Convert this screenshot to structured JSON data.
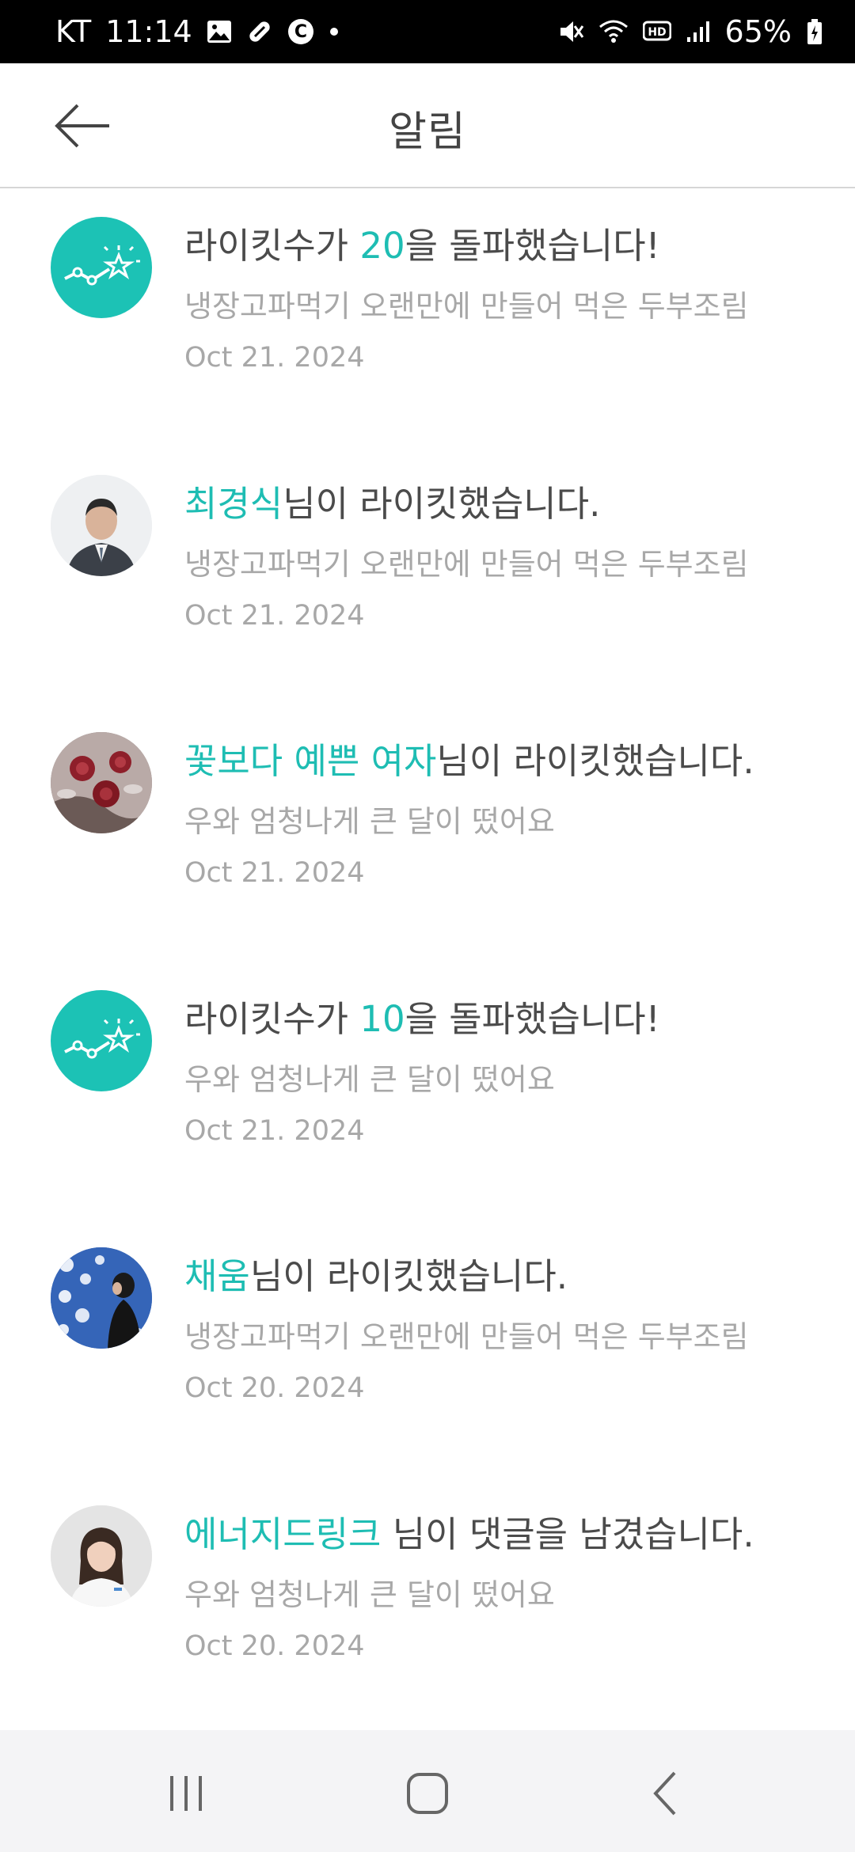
{
  "status_bar": {
    "carrier": "KT",
    "time": "11:14",
    "battery": "65%"
  },
  "app_bar": {
    "title": "알림"
  },
  "notifications": [
    {
      "type": "milestone",
      "prefix": "라이킷수가 ",
      "highlight": "20",
      "suffix": "을 돌파했습니다!",
      "subtitle": "냉장고파먹기 오랜만에 만들어 먹은 두부조림",
      "date": "Oct 21. 2024"
    },
    {
      "type": "like",
      "prefix": "",
      "highlight": "최경식",
      "suffix": "님이 라이킷했습니다.",
      "subtitle": "냉장고파먹기 오랜만에 만들어 먹은 두부조림",
      "date": "Oct 21. 2024"
    },
    {
      "type": "like",
      "prefix": "",
      "highlight": "꽃보다 예쁜 여자",
      "suffix": "님이 라이킷했습니다.",
      "subtitle": "우와 엄청나게 큰 달이 떴어요",
      "date": "Oct 21. 2024"
    },
    {
      "type": "milestone",
      "prefix": "라이킷수가 ",
      "highlight": "10",
      "suffix": "을 돌파했습니다!",
      "subtitle": "우와 엄청나게 큰 달이 떴어요",
      "date": "Oct 21. 2024"
    },
    {
      "type": "like",
      "prefix": "",
      "highlight": "채움",
      "suffix": "님이 라이킷했습니다.",
      "subtitle": "냉장고파먹기 오랜만에 만들어 먹은 두부조림",
      "date": "Oct 20. 2024"
    },
    {
      "type": "comment",
      "prefix": "",
      "highlight": "에너지드링크",
      "suffix": " 님이 댓글을 남겼습니다.",
      "subtitle": "우와 엄청나게 큰 달이 떴어요",
      "date": "Oct 20. 2024"
    }
  ],
  "colors": {
    "accent": "#1ebdb3",
    "milestone_bg": "#1cc2b5"
  }
}
